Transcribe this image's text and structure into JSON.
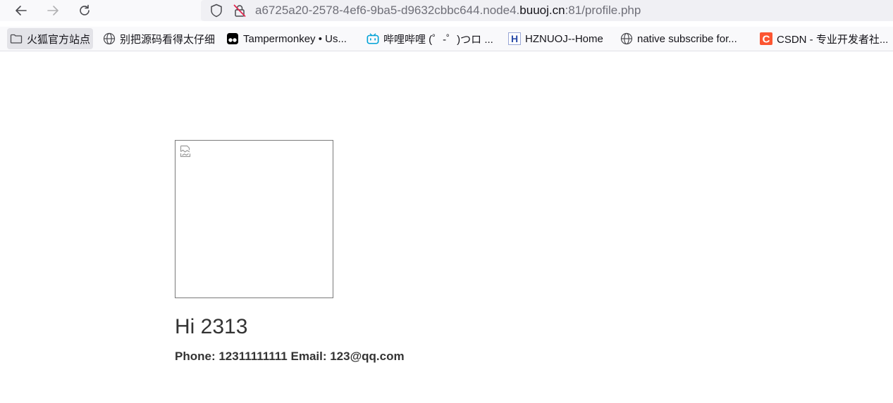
{
  "browser": {
    "url": {
      "prefix": "a6725a20-2578-4ef6-9ba5-d9632cbbc644.node4.",
      "domain": "buuoj.cn",
      "suffix": ":81/profile.php"
    },
    "bookmarks": [
      {
        "label": "火狐官方站点",
        "icon": "folder-icon"
      },
      {
        "label": "别把源码看得太仔细",
        "icon": "globe-icon"
      },
      {
        "label": "Tampermonkey • Us...",
        "icon": "tampermonkey-icon"
      },
      {
        "label": "哔哩哔哩 (゜-゜)つロ ...",
        "icon": "bilibili-icon"
      },
      {
        "label": "HZNUOJ--Home",
        "icon": "hznuoj-icon"
      },
      {
        "label": "native subscribe for...",
        "icon": "globe-icon"
      },
      {
        "label": "CSDN - 专业开发者社...",
        "icon": "csdn-icon"
      }
    ]
  },
  "profile": {
    "greeting": "Hi 2313",
    "contact": "Phone: 12311111111 Email: 123@qq.com"
  }
}
